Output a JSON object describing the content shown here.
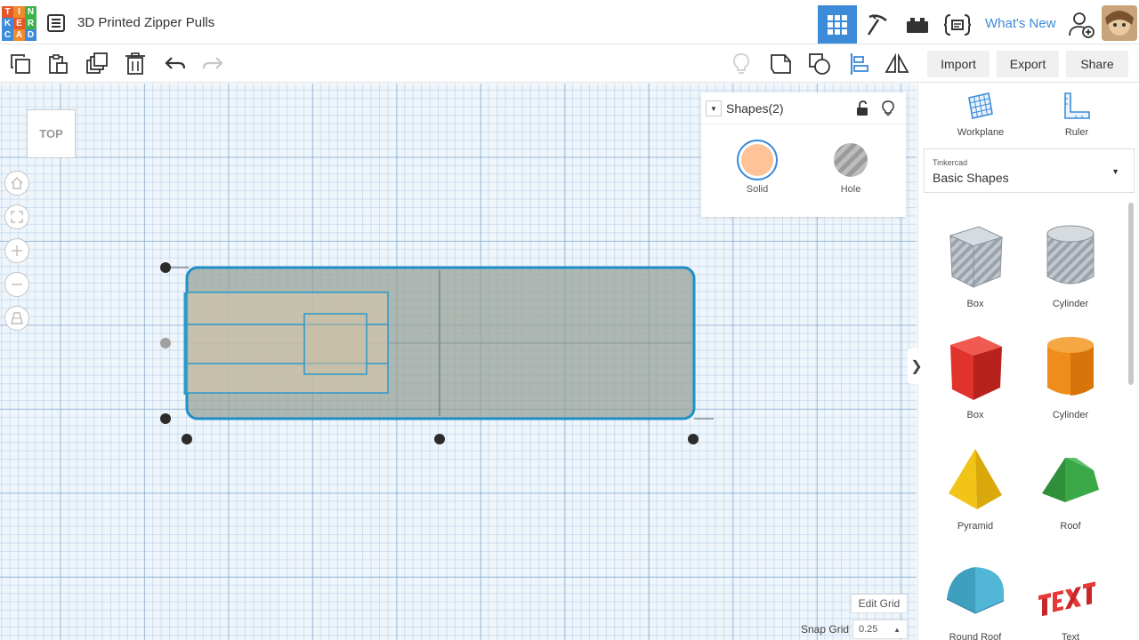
{
  "header": {
    "logo_letters": [
      "T",
      "I",
      "N",
      "K",
      "E",
      "R",
      "C",
      "A",
      "D"
    ],
    "logo_colors": [
      "#e6572a",
      "#f08a2a",
      "#3db24b",
      "#3c8bd9",
      "#e6572a",
      "#3db24b",
      "#3c8bd9",
      "#f08a2a",
      "#3c8bd9"
    ],
    "title": "3D Printed Zipper Pulls",
    "whats_new": "What's New",
    "icons": [
      "list-icon",
      "grid-3d-view-icon",
      "pickaxe-icon",
      "bricks-icon",
      "code-blocks-icon",
      "user-add-icon",
      "avatar"
    ]
  },
  "toolbar": {
    "import": "Import",
    "export": "Export",
    "share": "Share"
  },
  "canvas": {
    "view_label": "TOP",
    "edit_grid": "Edit Grid",
    "snap_grid_label": "Snap Grid",
    "snap_grid_value": "0.25",
    "snap_arrow": "▲"
  },
  "inspector": {
    "collapse": "▼",
    "title": "Shapes(2)",
    "solid_label": "Solid",
    "hole_label": "Hole",
    "solid_color": "#ffc299"
  },
  "right_panel": {
    "workplane": "Workplane",
    "ruler": "Ruler",
    "library_small": "Tinkercad",
    "library_name": "Basic Shapes",
    "library_arrow": "▼",
    "collapse_arrow": "❯",
    "shapes": [
      "Box",
      "Cylinder",
      "Box",
      "Cylinder",
      "Pyramid",
      "Roof",
      "Round Roof",
      "Text"
    ]
  },
  "colors": {
    "accent": "#3c8bd9",
    "selection": "#1f8fc7",
    "box_red": "#e0332b",
    "cylinder_orange": "#ef8c1b",
    "pyramid_yellow": "#f2c418",
    "roof_green": "#3aa846",
    "roundroof_blue": "#52b6d6"
  }
}
